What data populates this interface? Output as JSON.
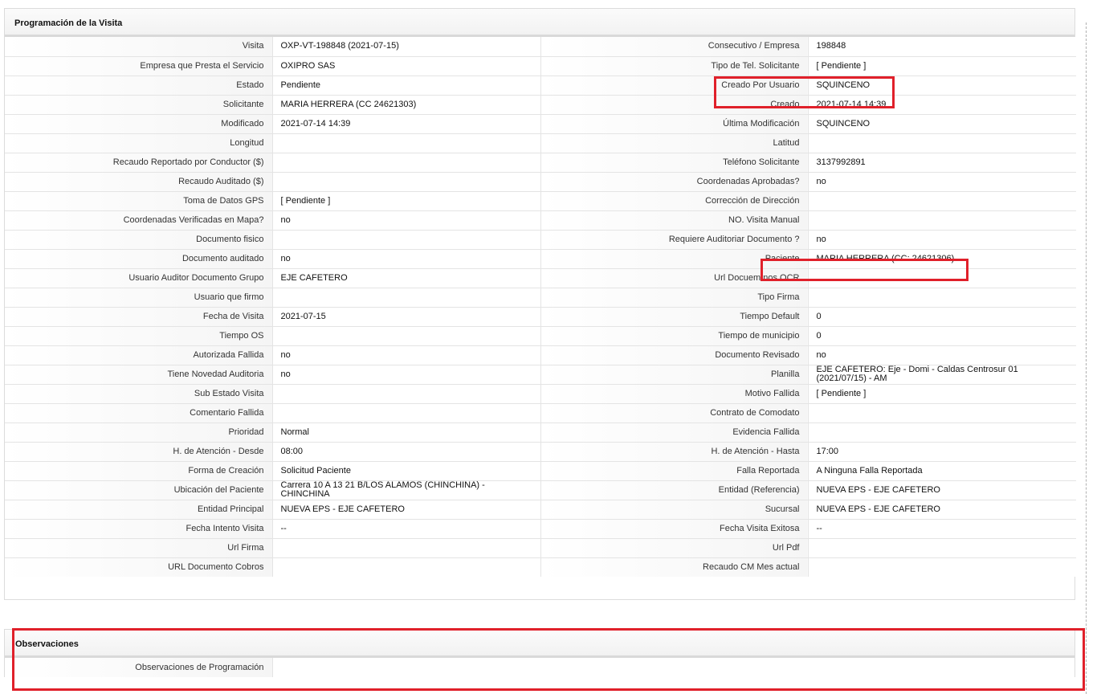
{
  "visit_panel": {
    "title": "Programación de la Visita",
    "rows": [
      {
        "l1": "Visita",
        "v1": "OXP-VT-198848 (2021-07-15)",
        "l2": "Consecutivo / Empresa",
        "v2": "198848"
      },
      {
        "l1": "Empresa que Presta el Servicio",
        "v1": "OXIPRO SAS",
        "l2": "Tipo de Tel. Solicitante",
        "v2": "[ Pendiente ]"
      },
      {
        "l1": "Estado",
        "v1": "Pendiente",
        "l2": "Creado Por Usuario",
        "v2": "SQUINCENO"
      },
      {
        "l1": "Solicitante",
        "v1": "MARIA HERRERA (CC 24621303)",
        "l2": "Creado",
        "v2": "2021-07-14 14:39"
      },
      {
        "l1": "Modificado",
        "v1": "2021-07-14 14:39",
        "l2": "Última Modificación",
        "v2": " SQUINCENO"
      },
      {
        "l1": "Longitud",
        "v1": "",
        "l2": "Latitud",
        "v2": ""
      },
      {
        "l1": "Recaudo Reportado por Conductor ($)",
        "v1": "",
        "l2": "Teléfono Solicitante",
        "v2": "3137992891"
      },
      {
        "l1": "Recaudo Auditado ($)",
        "v1": "",
        "l2": "Coordenadas Aprobadas?",
        "v2": " no"
      },
      {
        "l1": "Toma de Datos GPS",
        "v1": "[ Pendiente ]",
        "l2": "Corrección de Dirección",
        "v2": ""
      },
      {
        "l1": "Coordenadas Verificadas en Mapa?",
        "v1": " no",
        "l2": "NO. Visita Manual",
        "v2": ""
      },
      {
        "l1": "Documento fisico",
        "v1": "",
        "l2": "Requiere Auditoriar Documento ?",
        "v2": " no"
      },
      {
        "l1": "Documento auditado",
        "v1": " no",
        "l2": "Paciente",
        "v2": "MARIA HERRERA (CC: 24621306)"
      },
      {
        "l1": "Usuario Auditor Documento Grupo",
        "v1": "EJE CAFETERO",
        "l2": "Url Docuemtnos OCR",
        "v2": ""
      },
      {
        "l1": "Usuario que firmo",
        "v1": "",
        "l2": "Tipo Firma",
        "v2": ""
      },
      {
        "l1": "Fecha de Visita",
        "v1": " 2021-07-15",
        "l2": "Tiempo Default",
        "v2": "0"
      },
      {
        "l1": "Tiempo OS",
        "v1": "",
        "l2": "Tiempo de municipio",
        "v2": "0"
      },
      {
        "l1": "Autorizada Fallida",
        "v1": "no",
        "l2": "Documento Revisado",
        "v2": " no"
      },
      {
        "l1": "Tiene Novedad Auditoria",
        "v1": "no",
        "l2": "Planilla",
        "v2": "EJE CAFETERO: Eje - Domi - Caldas Centrosur 01 (2021/07/15) - AM"
      },
      {
        "l1": "Sub Estado Visita",
        "v1": "",
        "l2": "Motivo Fallida",
        "v2": "[ Pendiente ]"
      },
      {
        "l1": "Comentario Fallida",
        "v1": "",
        "l2": "Contrato de Comodato",
        "v2": ""
      },
      {
        "l1": "Prioridad",
        "v1": "Normal",
        "l2": "Evidencia Fallida",
        "v2": ""
      },
      {
        "l1": "H. de Atención - Desde",
        "v1": "08:00",
        "l2": "H. de Atención - Hasta",
        "v2": "17:00"
      },
      {
        "l1": "Forma de Creación",
        "v1": "Solicitud Paciente",
        "l2": "Falla Reportada",
        "v2": "A Ninguna Falla Reportada"
      },
      {
        "l1": "Ubicación del Paciente",
        "v1": "Carrera 10 A 13 21 B/LOS ALAMOS (CHINCHINA) - CHINCHINA",
        "l2": "Entidad (Referencia)",
        "v2": "NUEVA EPS - EJE CAFETERO"
      },
      {
        "l1": "Entidad Principal",
        "v1": "NUEVA EPS - EJE CAFETERO",
        "l2": "Sucursal",
        "v2": "NUEVA EPS - EJE CAFETERO"
      },
      {
        "l1": "Fecha Intento Visita",
        "v1": " --",
        "l2": "Fecha Visita Exitosa",
        "v2": " --"
      },
      {
        "l1": "Url Firma",
        "v1": "",
        "l2": "Url Pdf",
        "v2": ""
      },
      {
        "l1": "URL Documento Cobros",
        "v1": "",
        "l2": "Recaudo CM Mes actual",
        "v2": ""
      }
    ]
  },
  "observations_panel": {
    "title": "Observaciones",
    "rows": [
      {
        "label": "Observaciones de Programación",
        "value": ""
      }
    ]
  },
  "annotation_color": "#e0202a"
}
